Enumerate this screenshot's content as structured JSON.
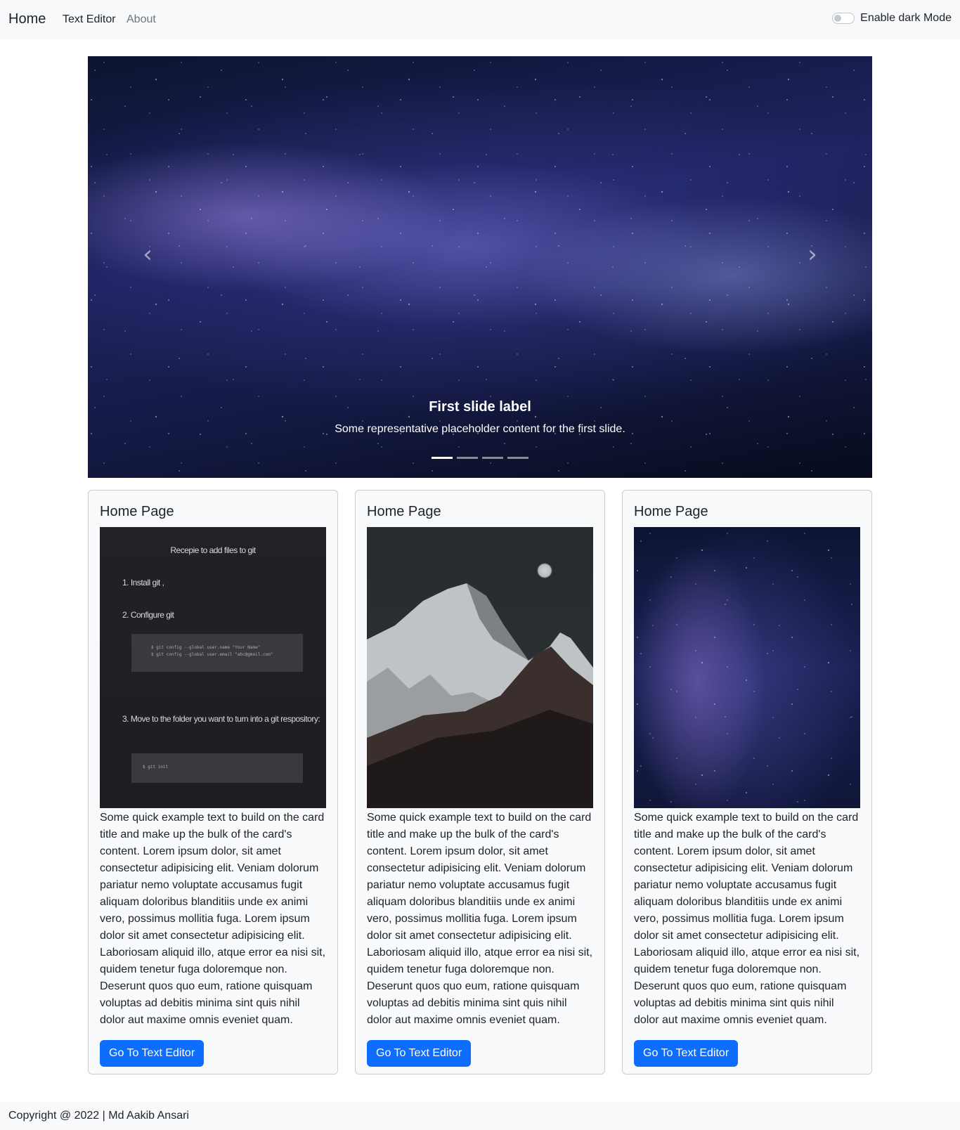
{
  "navbar": {
    "brand": "Home",
    "links": [
      "Text Editor",
      "About"
    ],
    "dark_mode_label": "Enable dark Mode"
  },
  "carousel": {
    "slide_title": "First slide label",
    "slide_text": "Some representative placeholder content for the first slide.",
    "prev_icon": "‹",
    "next_icon": "›",
    "indicator_count": 4,
    "active_indicator": 1
  },
  "cards": [
    {
      "title": "Home Page",
      "image": "git-instructions-image",
      "text": "Some quick example text to build on the card title and make up the bulk of the card's content. Lorem ipsum dolor, sit amet consectetur adipisicing elit. Veniam dolorum pariatur nemo voluptate accusamus fugit aliquam doloribus blanditiis unde ex animi vero, possimus mollitia fuga. Lorem ipsum dolor sit amet consectetur adipisicing elit. Laboriosam aliquid illo, atque error ea nisi sit, quidem tenetur fuga doloremque non. Deserunt quos quo eum, ratione quisquam voluptas ad debitis minima sint quis nihil dolor aut maxime omnis eveniet quam.",
      "button": "Go To Text Editor"
    },
    {
      "title": "Home Page",
      "image": "mountain-moon-image",
      "text": "Some quick example text to build on the card title and make up the bulk of the card's content. Lorem ipsum dolor, sit amet consectetur adipisicing elit. Veniam dolorum pariatur nemo voluptate accusamus fugit aliquam doloribus blanditiis unde ex animi vero, possimus mollitia fuga. Lorem ipsum dolor sit amet consectetur adipisicing elit. Laboriosam aliquid illo, atque error ea nisi sit, quidem tenetur fuga doloremque non. Deserunt quos quo eum, ratione quisquam voluptas ad debitis minima sint quis nihil dolor aut maxime omnis eveniet quam.",
      "button": "Go To Text Editor"
    },
    {
      "title": "Home Page",
      "image": "galaxy-image",
      "text": "Some quick example text to build on the card title and make up the bulk of the card's content. Lorem ipsum dolor, sit amet consectetur adipisicing elit. Veniam dolorum pariatur nemo voluptate accusamus fugit aliquam doloribus blanditiis unde ex animi vero, possimus mollitia fuga. Lorem ipsum dolor sit amet consectetur adipisicing elit. Laboriosam aliquid illo, atque error ea nisi sit, quidem tenetur fuga doloremque non. Deserunt quos quo eum, ratione quisquam voluptas ad debitis minima sint quis nihil dolor aut maxime omnis eveniet quam.",
      "button": "Go To Text Editor"
    }
  ],
  "git_image": {
    "title": "Recepie to add files to git",
    "step1": "1. Install git ,",
    "step2": "2. Configure git",
    "code1a": "$ git config --global user.name \"Your Name\"",
    "code1b": "$ git config --global user.email \"abc@gmail.com\"",
    "step3": "3. Move to the folder you want to turn into a git respository:",
    "code2": "$ git init"
  },
  "footer": {
    "text": "Copyright @ 2022 | Md Aakib Ansari"
  },
  "colors": {
    "primary": "#0d6efd",
    "navbar_bg": "#f8f9fa",
    "card_bg": "#f8f9fa"
  }
}
